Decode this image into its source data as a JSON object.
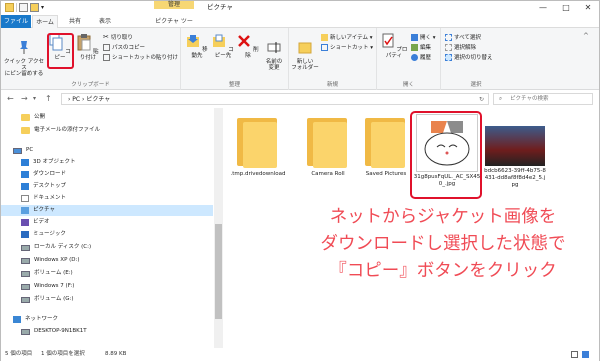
{
  "window": {
    "title": "ピクチャ",
    "context_tab": "管理",
    "minimize": "—",
    "maximize": "□",
    "close": "✕"
  },
  "tabs": [
    "ファイル",
    "ホーム",
    "共有",
    "表示",
    "ピクチャ ツール"
  ],
  "ribbon": {
    "pin_quick": "クイック アクセス\nにピン留めする",
    "copy": "コピー",
    "paste": "貼り付け",
    "cut": "切り取り",
    "copy_path": "パスのコピー",
    "paste_shortcut": "ショートカットの貼り付け",
    "clipboard_group": "クリップボード",
    "move_to": "移動先",
    "copy_to": "コピー先",
    "delete": "削除",
    "rename": "名前の\n変更",
    "organize_group": "整理",
    "new_folder": "新しい\nフォルダー",
    "new_item": "新しいアイテム ▾",
    "shortcut": "ショートカット ▾",
    "new_group": "新規",
    "properties": "プロパティ",
    "open": "開く ▾",
    "edit": "編集",
    "history": "履歴",
    "open_group": "開く",
    "select_all": "すべて選択",
    "select_none": "選択解除",
    "invert": "選択の切り替え",
    "select_group": "選択"
  },
  "address": {
    "path": "›  PC  ›  ピクチャ",
    "search_placeholder": "ピクチャの検索"
  },
  "nav_items": [
    {
      "label": "公開",
      "icon": "folder"
    },
    {
      "label": "電子メールの添付ファイル",
      "icon": "folder"
    },
    {
      "label": "PC",
      "icon": "pc"
    },
    {
      "label": "3D オブジェクト",
      "icon": "blue"
    },
    {
      "label": "ダウンロード",
      "icon": "blue"
    },
    {
      "label": "デスクトップ",
      "icon": "blue"
    },
    {
      "label": "ドキュメント",
      "icon": "doc"
    },
    {
      "label": "ピクチャ",
      "icon": "pic"
    },
    {
      "label": "ビデオ",
      "icon": "blue"
    },
    {
      "label": "ミュージック",
      "icon": "blue"
    },
    {
      "label": "ローカル ディスク (C:)",
      "icon": "drive"
    },
    {
      "label": "Windows XP (D:)",
      "icon": "drive"
    },
    {
      "label": "ボリューム (E:)",
      "icon": "drive"
    },
    {
      "label": "Windows 7 (F:)",
      "icon": "drive"
    },
    {
      "label": "ボリューム (G:)",
      "icon": "drive"
    },
    {
      "label": "ネットワーク",
      "icon": "net"
    },
    {
      "label": "DESKTOP-9N1BK1T",
      "icon": "pc"
    }
  ],
  "files": [
    {
      "name": ".tmp.drivedownload",
      "type": "folder"
    },
    {
      "name": "Camera Roll",
      "type": "folder"
    },
    {
      "name": "Saved Pictures",
      "type": "folder"
    },
    {
      "name": "31g8pusFqUL._AC_SX450_.jpg",
      "type": "image"
    },
    {
      "name": "bdcb6623-39ff-4b75-8431-dd8af8f8d4e2_5.jpg",
      "type": "image"
    }
  ],
  "annotation": {
    "line1": "ネットからジャケット画像を",
    "line2": "ダウンロードし選択した状態で",
    "line3": "『コピー』ボタンをクリック"
  },
  "status": {
    "count": "5 個の項目",
    "selection": "1 個の項目を選択",
    "size": "8.89 KB"
  }
}
